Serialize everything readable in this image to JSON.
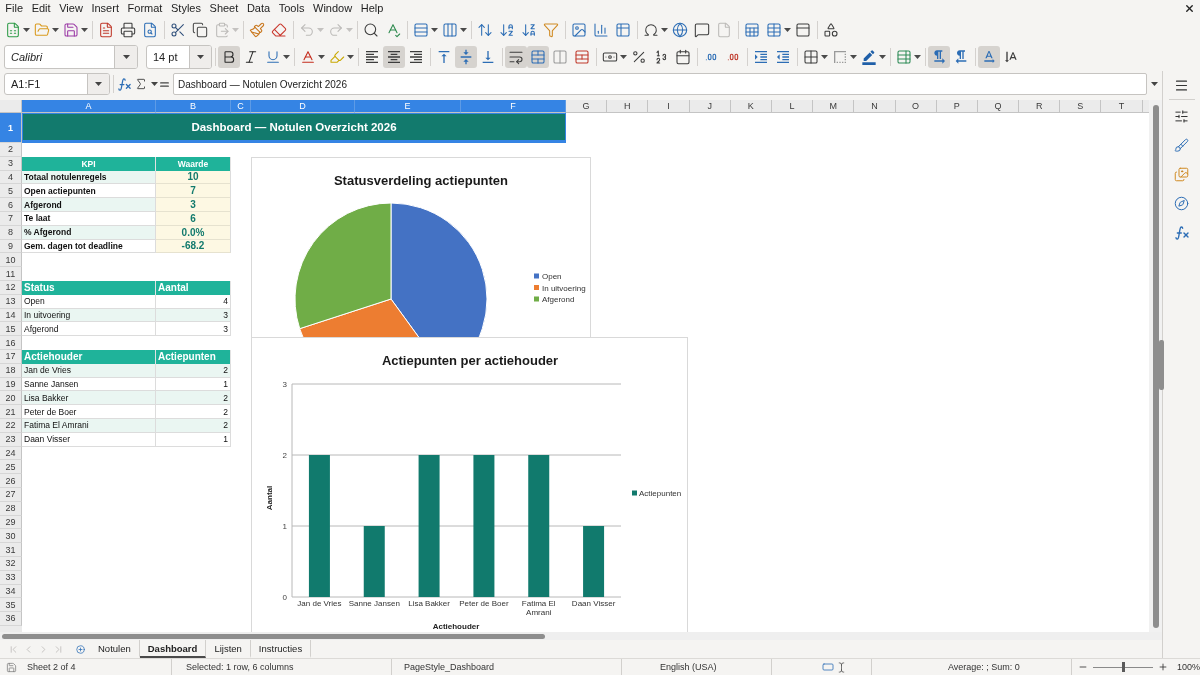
{
  "menu_bar": {
    "items": [
      {
        "label": "File"
      },
      {
        "label": "Edit"
      },
      {
        "label": "View"
      },
      {
        "label": "Insert"
      },
      {
        "label": "Format"
      },
      {
        "label": "Styles"
      },
      {
        "label": "Sheet"
      },
      {
        "label": "Data"
      },
      {
        "label": "Tools"
      },
      {
        "label": "Window"
      },
      {
        "label": "Help"
      }
    ]
  },
  "standard_toolbar": {
    "paste_disabled": true,
    "undo_disabled": true,
    "redo_disabled": true,
    "headers_footers_disabled": true
  },
  "formatting_toolbar": {
    "font_name": "Calibri",
    "font_size": "14 pt",
    "bold": true,
    "italic": false,
    "underline": false,
    "align_left": false,
    "align_center": true,
    "align_right": false,
    "align_top": false,
    "align_middle": true,
    "align_bottom": false,
    "wrap_text": true,
    "merge_and_center": true,
    "left_to_right": true,
    "right_to_left": false,
    "text_horizontal": true,
    "text_vertical": false
  },
  "formula_bar": {
    "name_box": "A1:F1",
    "formula": "Dashboard — Notulen Overzicht 2026"
  },
  "sheet": {
    "columns": [
      {
        "label": "A",
        "selected": true
      },
      {
        "label": "B",
        "selected": true
      },
      {
        "label": "C",
        "selected": true
      },
      {
        "label": "D",
        "selected": true
      },
      {
        "label": "E",
        "selected": true
      },
      {
        "label": "F",
        "selected": true
      },
      {
        "label": "G",
        "selected": false
      },
      {
        "label": "H",
        "selected": false
      },
      {
        "label": "I",
        "selected": false
      },
      {
        "label": "J",
        "selected": false
      },
      {
        "label": "K",
        "selected": false
      },
      {
        "label": "L",
        "selected": false
      },
      {
        "label": "M",
        "selected": false
      },
      {
        "label": "N",
        "selected": false
      },
      {
        "label": "O",
        "selected": false
      },
      {
        "label": "P",
        "selected": false
      },
      {
        "label": "Q",
        "selected": false
      },
      {
        "label": "R",
        "selected": false
      },
      {
        "label": "S",
        "selected": false
      },
      {
        "label": "T",
        "selected": false
      }
    ],
    "rows": [
      {
        "label": "1",
        "selected": true
      },
      {
        "label": "2",
        "selected": false
      },
      {
        "label": "3",
        "selected": false
      },
      {
        "label": "4",
        "selected": false
      },
      {
        "label": "5",
        "selected": false
      },
      {
        "label": "6",
        "selected": false
      },
      {
        "label": "7",
        "selected": false
      },
      {
        "label": "8",
        "selected": false
      },
      {
        "label": "9",
        "selected": false
      },
      {
        "label": "10",
        "selected": false
      },
      {
        "label": "11",
        "selected": false
      },
      {
        "label": "12",
        "selected": false
      },
      {
        "label": "13",
        "selected": false
      },
      {
        "label": "14",
        "selected": false
      },
      {
        "label": "15",
        "selected": false
      },
      {
        "label": "16",
        "selected": false
      },
      {
        "label": "17",
        "selected": false
      },
      {
        "label": "18",
        "selected": false
      },
      {
        "label": "19",
        "selected": false
      },
      {
        "label": "20",
        "selected": false
      },
      {
        "label": "21",
        "selected": false
      },
      {
        "label": "22",
        "selected": false
      },
      {
        "label": "23",
        "selected": false
      },
      {
        "label": "24",
        "selected": false
      },
      {
        "label": "25",
        "selected": false
      },
      {
        "label": "26",
        "selected": false
      },
      {
        "label": "27",
        "selected": false
      },
      {
        "label": "28",
        "selected": false
      },
      {
        "label": "29",
        "selected": false
      },
      {
        "label": "30",
        "selected": false
      },
      {
        "label": "31",
        "selected": false
      },
      {
        "label": "32",
        "selected": false
      },
      {
        "label": "33",
        "selected": false
      },
      {
        "label": "34",
        "selected": false
      },
      {
        "label": "35",
        "selected": false
      },
      {
        "label": "36",
        "selected": false
      }
    ],
    "title_cell": "Dashboard — Notulen Overzicht 2026",
    "kpi_table": {
      "headers": [
        "KPI",
        "Waarde"
      ],
      "rows": [
        {
          "label": "Totaal notulenregels",
          "value": "10"
        },
        {
          "label": "Open actiepunten",
          "value": "7"
        },
        {
          "label": "Afgerond",
          "value": "3"
        },
        {
          "label": "Te laat",
          "value": "6"
        },
        {
          "label": "% Afgerond",
          "value": "0.0%"
        },
        {
          "label": "Gem. dagen tot deadline",
          "value": "-68.2"
        }
      ]
    },
    "status_table": {
      "headers": [
        "Status",
        "Aantal"
      ],
      "rows": [
        {
          "label": "Open",
          "value": "4"
        },
        {
          "label": "In uitvoering",
          "value": "3"
        },
        {
          "label": "Afgerond",
          "value": "3"
        }
      ]
    },
    "owner_table": {
      "headers": [
        "Actiehouder",
        "Actiepunten"
      ],
      "rows": [
        {
          "label": "Jan de Vries",
          "value": "2"
        },
        {
          "label": "Sanne Jansen",
          "value": "1"
        },
        {
          "label": "Lisa Bakker",
          "value": "2"
        },
        {
          "label": "Peter de Boer",
          "value": "2"
        },
        {
          "label": "Fatima El Amrani",
          "value": "2"
        },
        {
          "label": "Daan Visser",
          "value": "1"
        }
      ]
    },
    "charts": [
      {
        "chart_data": {
          "type": "pie",
          "title": "Statusverdeling actiepunten",
          "categories": [
            "Open",
            "In uitvoering",
            "Afgerond"
          ],
          "values": [
            40,
            30,
            30
          ],
          "legend": "right"
        },
        "slices": [
          {
            "color": "#4472c4"
          },
          {
            "color": "#ed7d31"
          },
          {
            "color": "#70ad47"
          }
        ]
      },
      {
        "chart_data": {
          "type": "bar",
          "title": "Actiepunten per actiehouder",
          "xlabel": "Actiehouder",
          "ylabel": "Aantal",
          "categories": [
            "Jan de Vries",
            "Sanne Jansen",
            "Lisa Bakker",
            "Peter de Boer",
            "Fatima El Amrani",
            "Daan Visser"
          ],
          "series": [
            {
              "name": "Actiepunten",
              "color": "#117a6d",
              "values": [
                2,
                1,
                2,
                2,
                2,
                1
              ]
            }
          ],
          "ylim": [
            0,
            3
          ],
          "yticks": [
            0,
            1,
            2,
            3
          ],
          "legend": "right"
        }
      }
    ]
  },
  "sheet_tabs": {
    "navigation_disabled": true,
    "tabs": [
      {
        "label": "Notulen",
        "selected": false
      },
      {
        "label": "Dashboard",
        "selected": true
      },
      {
        "label": "Lijsten",
        "selected": false
      },
      {
        "label": "Instructies",
        "selected": false
      }
    ]
  },
  "status_bar": {
    "sheet_position": "Sheet 2 of 4",
    "selection": "Selected: 1 row, 6 columns",
    "page_style": "PageStyle_Dashboard",
    "language": "English (USA)",
    "summary": "Average: ; Sum: 0",
    "zoom_slider": {
      "level": 0.5
    },
    "zoom": "100%"
  }
}
